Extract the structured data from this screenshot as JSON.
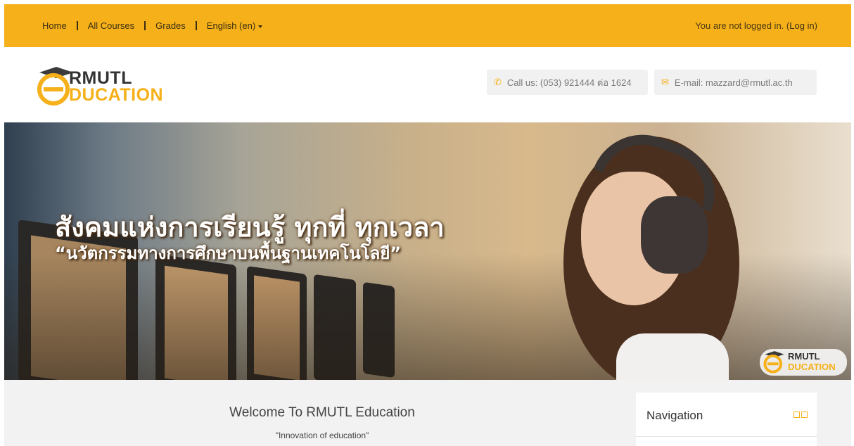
{
  "topbar": {
    "nav": [
      {
        "label": "Home"
      },
      {
        "label": "All Courses"
      },
      {
        "label": "Grades"
      },
      {
        "label": "English (en)"
      }
    ],
    "login_prefix": "You are not logged in. (",
    "login_link": "Log in",
    "login_suffix": ")"
  },
  "header": {
    "logo_line1": "RMUTL",
    "logo_line2": "DUCATION",
    "phone_icon": "phone-icon",
    "phone_text": "Call us: (053) 921444 ต่อ 1624",
    "mail_icon": "envelope-icon",
    "mail_text": "E-mail: mazzard@rmutl.ac.th"
  },
  "banner": {
    "title": "สังคมแห่งการเรียนรู้ ทุกที่ ทุกเวลา",
    "subtitle": "“นวัตกรรมทางการศึกษาบนพื้นฐานเทคโนโลยี”",
    "logo_line1": "RMUTL",
    "logo_line2": "DUCATION"
  },
  "main": {
    "welcome": "Welcome To RMUTL Education",
    "tagline": "\"Innovation of education\""
  },
  "navigation_block": {
    "title": "Navigation"
  },
  "colors": {
    "accent": "#f6b01a",
    "page_bg": "#f2f2f2"
  }
}
